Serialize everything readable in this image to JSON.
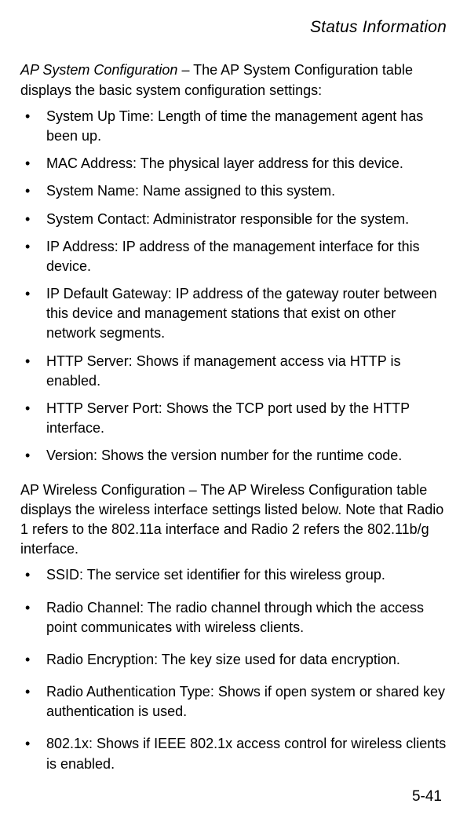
{
  "header": "Status Information",
  "section1": {
    "lead": "AP System Configuration",
    "intro_rest": " – The AP System Configuration table displays the basic system configuration settings:",
    "items": [
      "System Up Time: Length of time the management agent has been up.",
      "MAC Address: The physical layer address for this device.",
      "System Name: Name assigned to this system.",
      "System Contact: Administrator responsible for the system.",
      "IP Address: IP address of the management interface for this device.",
      "IP Default Gateway: IP address of the gateway router between this device and management stations that exist on other network segments.",
      "HTTP Server: Shows if management access via HTTP is enabled.",
      "HTTP Server Port: Shows the TCP port used by the HTTP interface.",
      "Version: Shows the version number for the runtime code."
    ]
  },
  "section2": {
    "intro": "AP Wireless Configuration – The AP Wireless Configuration table displays the wireless interface settings listed below. Note that Radio 1 refers to the 802.11a interface and Radio 2 refers the 802.11b/g interface.",
    "items": [
      "SSID: The service set identifier for this wireless group.",
      "Radio Channel: The radio channel through which the access point communicates with wireless clients.",
      "Radio Encryption: The key size used for data encryption.",
      "Radio Authentication Type: Shows if open system or shared key authentication is used.",
      "802.1x: Shows if IEEE 802.1x access control for wireless clients is enabled."
    ]
  },
  "page_number": "5-41"
}
